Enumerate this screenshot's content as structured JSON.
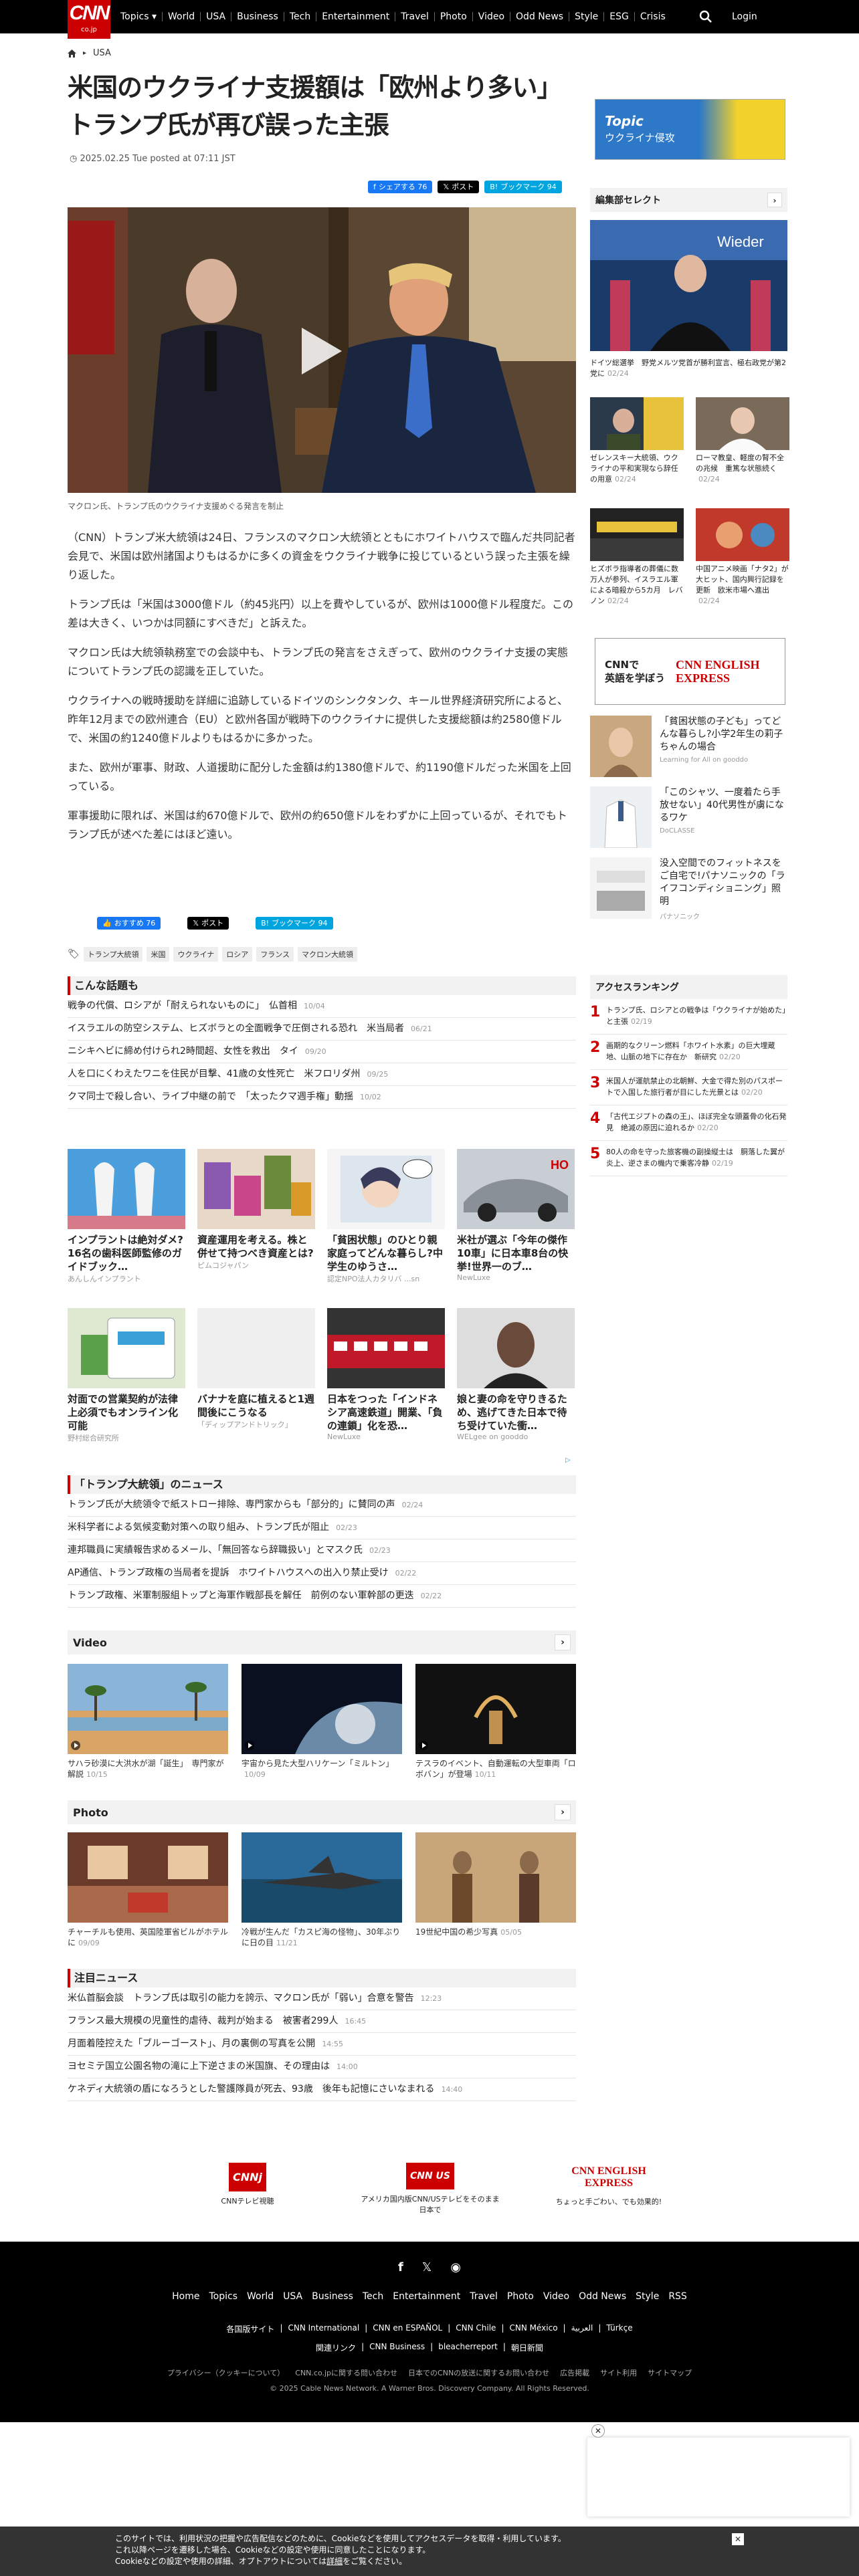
{
  "header": {
    "logo_main": "CNN",
    "logo_sub": "co.jp",
    "nav": [
      "Topics ▾",
      "World",
      "USA",
      "Business",
      "Tech",
      "Entertainment",
      "Travel",
      "Photo",
      "Video",
      "Odd News",
      "Style",
      "ESG",
      "Crisis"
    ],
    "login": "Login"
  },
  "breadcrumb": {
    "section": "USA"
  },
  "article": {
    "title_line1": "米国のウクライナ支援額は「欧州より多い」",
    "title_line2": "トランプ氏が再び誤った主張",
    "date": "2025.02.25 Tue posted at 07:11 JST",
    "share": {
      "fb": "シェアする 76",
      "x": "ポスト",
      "hatena": "ブックマーク 94"
    },
    "caption": "マクロン氏、トランプ氏のウクライナ支援めぐる発言を制止",
    "paragraphs": [
      "（CNN）トランプ米大統領は24日、フランスのマクロン大統領とともにホワイトハウスで臨んだ共同記者会見で、米国は欧州諸国よりもはるかに多くの資金をウクライナ戦争に投じているという誤った主張を繰り返した。",
      "トランプ氏は「米国は3000億ドル（約45兆円）以上を費やしているが、欧州は1000億ドル程度だ。この差は大きく、いつかは同額にすべきだ」と訴えた。",
      "マクロン氏は大統領執務室での会談中も、トランプ氏の発言をさえぎって、欧州のウクライナ支援の実態についてトランプ氏の認識を正していた。",
      "ウクライナへの戦時援助を詳細に追跡しているドイツのシンクタンク、キール世界経済研究所によると、昨年12月までの欧州連合（EU）と欧州各国が戦時下のウクライナに提供した支援総額は約2580億ドルで、米国の約1240億ドルよりもはるかに多かった。",
      "また、欧州が軍事、財政、人道援助に配分した金額は約1380億ドルで、約1190億ドルだった米国を上回っている。",
      "軍事援助に限れば、米国は約670億ドルで、欧州の約650億ドルをわずかに上回っているが、それでもトランプ氏が述べた差にはほど遠い。"
    ],
    "share2": {
      "fb": "おすすめ 76",
      "x": "ポスト",
      "hatena": "ブックマーク 94"
    },
    "tags": [
      "トランプ大統領",
      "米国",
      "ウクライナ",
      "ロシア",
      "フランス",
      "マクロン大統領"
    ]
  },
  "related": {
    "title": "こんな話題も",
    "items": [
      {
        "t": "戦争の代償、ロシアが「耐えられないものに」　仏首相",
        "d": "10/04"
      },
      {
        "t": "イスラエルの防空システム、ヒズボラとの全面戦争で圧倒される恐れ　米当局者",
        "d": "06/21"
      },
      {
        "t": "ニシキヘビに締め付けられ2時間超、女性を救出　タイ",
        "d": "09/20"
      },
      {
        "t": "人を口にくわえたワニを住民が目撃、41歳の女性死亡　米フロリダ州",
        "d": "09/25"
      },
      {
        "t": "クマ同士で殺し合い、ライブ中継の前で　「太ったクマ週手権」動揺",
        "d": "10/02"
      }
    ]
  },
  "ads": [
    {
      "t": "インプラントは絶対ダメ?16名の歯科医師監修のガイドブック…",
      "s": "あんしんインプラント"
    },
    {
      "t": "資産運用を考える。株と併せて持つべき資産とは?",
      "s": "ピムコジャパン"
    },
    {
      "t": "「貧困状態」のひとり親家庭ってどんな暮らし?中学生のゆうさ…",
      "s": "認定NPO法人カタリバ ...sn"
    },
    {
      "t": "米社が選ぶ「今年の傑作10車」に日本車8台の快挙!世界一のブ…",
      "s": "NewLuxe"
    },
    {
      "t": "対面での営業契約が法律上必須でもオンライン化可能",
      "s": "野村総合研究所"
    },
    {
      "t": "バナナを庭に植えると1週間後にこうなる",
      "s": "「ディップアンドトリック」"
    },
    {
      "t": "日本をつった「インドネシア高速鉄道」開業、「負の連鎖」化を恐…",
      "s": "NewLuxe"
    },
    {
      "t": "娘と妻の命を守りきるため、逃げてきた日本で待ち受けていた衝…",
      "s": "WELgee on gooddo"
    }
  ],
  "trump_news": {
    "title": "「トランプ大統領」のニュース",
    "items": [
      {
        "t": "トランプ氏が大統領令で紙ストロー排除、専門家からも「部分的」に賛同の声",
        "d": "02/24"
      },
      {
        "t": "米科学者による気候変動対策への取り組み、トランプ氏が阻止",
        "d": "02/23"
      },
      {
        "t": "連邦職員に実績報告求めるメール、「無回答なら辞職扱い」とマスク氏",
        "d": "02/23"
      },
      {
        "t": "AP通信、トランプ政権の当局者を提訴　ホワイトハウスへの出入り禁止受け",
        "d": "02/22"
      },
      {
        "t": "トランプ政権、米軍制服組トップと海軍作戦部長を解任　前例のない軍幹部の更迭",
        "d": "02/22"
      }
    ]
  },
  "video": {
    "title": "Video",
    "items": [
      {
        "t": "サハラ砂漠に大洪水が湖「誕生」　専門家が解説",
        "d": "10/15"
      },
      {
        "t": "宇宙から見た大型ハリケーン「ミルトン」",
        "d": "10/09"
      },
      {
        "t": "テスラのイベント、自動運転の大型車両「ロボバン」が登場",
        "d": "10/11"
      }
    ]
  },
  "photo": {
    "title": "Photo",
    "items": [
      {
        "t": "チャーチルも使用、英国陸軍省ビルがホテルに",
        "d": "09/09"
      },
      {
        "t": "冷戦が生んだ「カスピ海の怪物」、30年ぶりに日の目",
        "d": "11/21"
      },
      {
        "t": "19世紀中国の希少写真",
        "d": "05/05"
      }
    ]
  },
  "notable": {
    "title": "注目ニュース",
    "items": [
      {
        "t": "米仏首脳会談　トランプ氏は取引の能力を誇示、マクロン氏が「弱い」合意を警告",
        "d": "12:23"
      },
      {
        "t": "フランス最大規模の児童性的虐待、裁判が始まる　被害者299人",
        "d": "16:45"
      },
      {
        "t": "月面着陸控えた「ブルーゴースト」、月の裏側の写真を公開",
        "d": "14:55"
      },
      {
        "t": "ヨセミテ国立公園名物の滝に上下逆さまの米国旗、その理由は",
        "d": "14:00"
      },
      {
        "t": "ケネディ大統領の盾になろうとした警護隊員が死去、93歳　後年も記憶にさいなまれる",
        "d": "14:40"
      }
    ]
  },
  "banners": [
    {
      "logo": "CNNj",
      "t": "CNNテレビ視聴"
    },
    {
      "logo": "CNN US",
      "t": "アメリカ国内版CNN/USテレビをそのまま日本で"
    },
    {
      "logo": "CNN ENGLISH EXPRESS",
      "t": "ちょっと手ごわい、でも効果的!"
    }
  ],
  "sidebar": {
    "topic": {
      "t1": "Topic",
      "t2": "ウクライナ侵攻"
    },
    "editor_title": "編集部セレクト",
    "editor_main": {
      "t": "ドイツ総選挙　野党メルツ党首が勝利宣言、極右政党が第2党に",
      "d": "02/24"
    },
    "editor_items": [
      {
        "t": "ゼレンスキー大統領、ウクライナの平和実現なら辞任の用意",
        "d": "02/24"
      },
      {
        "t": "ローマ教皇、軽度の腎不全の兆候　重篤な状態続く",
        "d": "02/24"
      },
      {
        "t": "ヒズボラ指導者の葬儀に数万人が参列、イスラエル軍による暗殺から5カ月　レバノン",
        "d": "02/24"
      },
      {
        "t": "中国アニメ映画「ナタ2」が大ヒット、国内興行記録を更新　欧米市場へ進出",
        "d": "02/24"
      }
    ],
    "ad_banner": {
      "l": "CNNで\n英語を学ぼう",
      "r": "CNN ENGLISH EXPRESS"
    },
    "ad_items": [
      {
        "t": "「貧困状態の子ども」ってどんな暮らし?小学2年生の莉子ちゃんの場合",
        "s": "Learning for All on gooddo"
      },
      {
        "t": "「このシャツ、一度着たら手放せない」40代男性が虜になるワケ",
        "s": "DoCLASSE"
      },
      {
        "t": "没入空間でのフィットネスをご自宅で!パナソニックの「ライフコンディショニング」照明",
        "s": "パナソニック"
      }
    ],
    "ranking_title": "アクセスランキング",
    "ranking": [
      {
        "n": "1",
        "t": "トランプ氏、ロシアとの戦争は「ウクライナが始めた」と主張",
        "d": "02/19"
      },
      {
        "n": "2",
        "t": "画期的なクリーン燃料「ホワイト水素」の巨大埋蔵地、山脈の地下に存在か　新研究",
        "d": "02/20"
      },
      {
        "n": "3",
        "t": "米国人が運航禁止の北朝鮮、大金で得た別のパスポートで入国した旅行者が目にした光景とは",
        "d": "02/20"
      },
      {
        "n": "4",
        "t": "「古代エジプトの森の王」、ほぼ完全な頭蓋骨の化石発見　絶滅の原因に迫れるか",
        "d": "02/20"
      },
      {
        "n": "5",
        "t": "80人の命を守った旅客機の副操縦士は　胴落した翼が炎上、逆さまの機内で乗客冷静",
        "d": "02/19"
      }
    ]
  },
  "footer": {
    "nav": [
      "Home",
      "Topics",
      "World",
      "USA",
      "Business",
      "Tech",
      "Entertainment",
      "Travel",
      "Photo",
      "Video",
      "Odd News",
      "Style",
      "RSS"
    ],
    "sub1": [
      "各国版サイト",
      "CNN International",
      "CNN en ESPAÑOL",
      "CNN Chile",
      "CNN México",
      "العربية",
      "Türkçe"
    ],
    "sub2": [
      "関連リンク",
      "CNN Business",
      "bleacherreport",
      "朝日新聞"
    ],
    "links": [
      "プライバシー（クッキーについて）",
      "CNN.co.jpに関する問い合わせ",
      "日本でのCNNの放送に関するお問い合わせ",
      "広告掲載",
      "サイト利用",
      "サイトマップ"
    ],
    "copyright": "© 2025 Cable News Network. A Warner Bros. Discovery Company. All Rights Reserved."
  },
  "cookie": {
    "l1": "このサイトでは、利用状況の把握や広告配信などのために、Cookieなどを使用してアクセスデータを取得・利用しています。",
    "l2": "これ以降ページを遷移した場合、Cookieなどの設定や使用に同意したことになります。",
    "l3": "Cookieなどの設定や使用の詳細、オプトアウトについては",
    "link": "詳細",
    "l3b": "をご覧ください。"
  }
}
